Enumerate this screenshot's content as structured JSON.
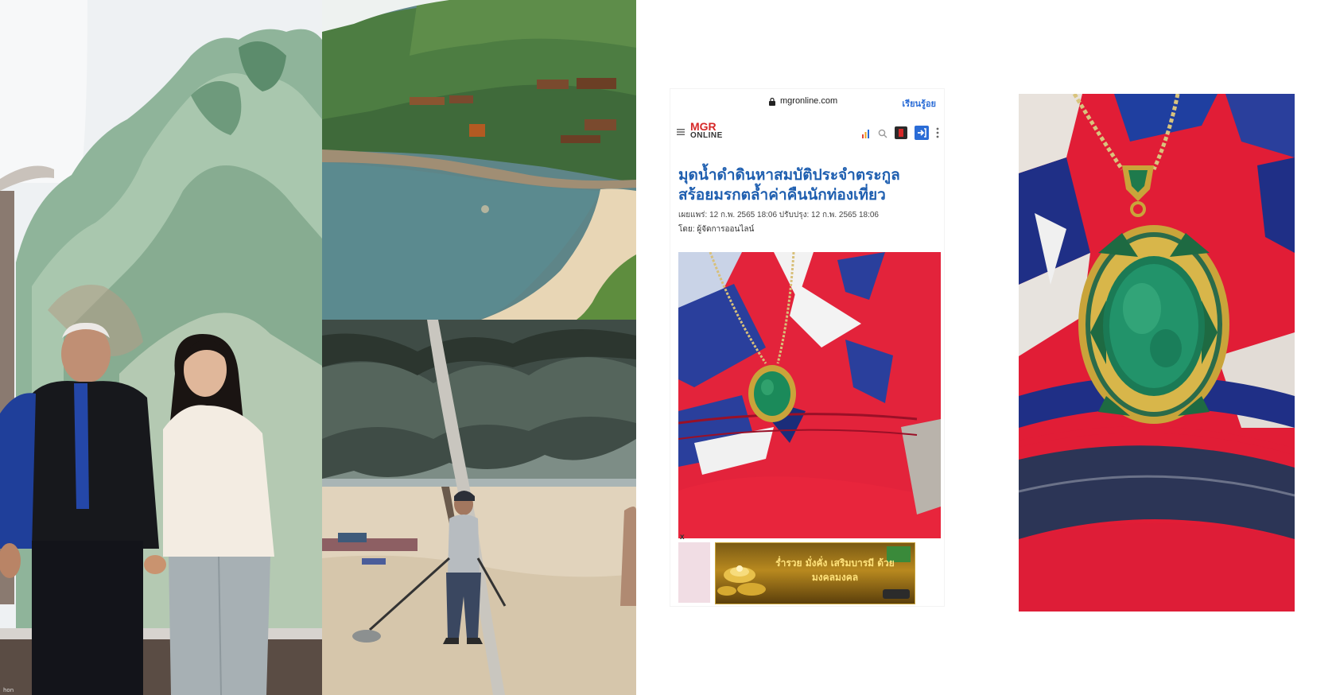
{
  "photos": {
    "couple": {
      "watermark": "hon"
    },
    "bay": {},
    "beach": {},
    "pendant": {}
  },
  "phone": {
    "url": "mgronline.com",
    "header_link": "เรียนรู้อย",
    "logo_top": "MGR",
    "logo_bottom": "ONLINE",
    "article": {
      "title": "มุดน้ำดำดินหาสมบัติประจำตระกูล สร้อยมรกตล้ำค่าคืนนักท่องเที่ยว",
      "meta": "เผยแพร่: 12 ก.พ. 2565 18:06   ปรับปรุง: 12 ก.พ. 2565 18:06",
      "byline": "โดย: ผู้จัดการออนไลน์"
    },
    "ad": {
      "text": "ร่ำรวย มั่งคั่ง เสริมบารมี ด้วย มงคลมงคล",
      "close": "x"
    }
  },
  "colors": {
    "link_blue": "#1f5fb0",
    "brand_red": "#d62828",
    "shirt_red": "#e11d36",
    "shirt_blue": "#1f3fa0",
    "emerald": "#1b8a5a",
    "gold": "#c9a43a"
  }
}
